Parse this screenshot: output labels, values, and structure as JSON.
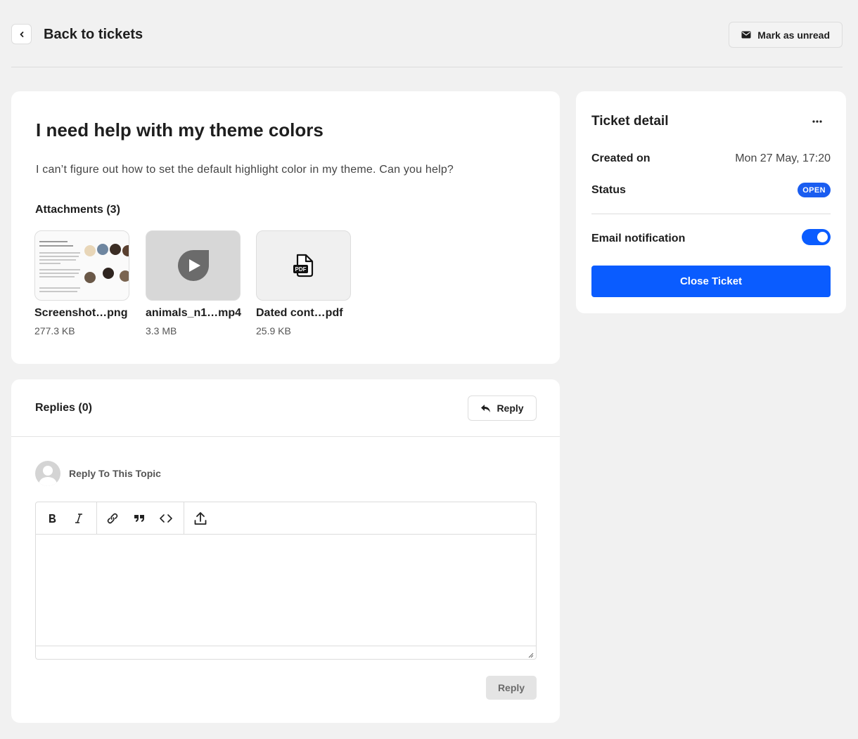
{
  "header": {
    "back_label": "Back to tickets",
    "mark_unread_label": "Mark as unread"
  },
  "ticket": {
    "title": "I need help with my theme colors",
    "description": "I can’t figure out how to set the default highlight color in my theme. Can you help?",
    "attachments_heading": "Attachments (3)",
    "attachments": [
      {
        "name": "Screenshot…png",
        "size": "277.3 KB",
        "kind": "image-thumbnail"
      },
      {
        "name": "animals_n1…mp4",
        "size": "3.3 MB",
        "kind": "play-icon"
      },
      {
        "name": "Dated cont…pdf",
        "size": "25.9 KB",
        "kind": "pdf-icon",
        "icon_text": "PDF"
      }
    ]
  },
  "replies": {
    "title": "Replies (0)",
    "reply_button_label": "Reply",
    "reply_to_label": "Reply To This Topic",
    "toolbar_icons": [
      "bold-icon",
      "italic-icon",
      "link-icon",
      "quote-icon",
      "code-icon",
      "upload-icon"
    ],
    "submit_label": "Reply"
  },
  "detail": {
    "title": "Ticket detail",
    "created_label": "Created on",
    "created_value": "Mon 27 May, 17:20",
    "status_label": "Status",
    "status_value": "OPEN",
    "email_label": "Email notification",
    "email_enabled": true,
    "close_label": "Close Ticket"
  },
  "colors": {
    "accent": "#0a5cff",
    "badge": "#1a5df0",
    "background": "#f1f1f1"
  }
}
